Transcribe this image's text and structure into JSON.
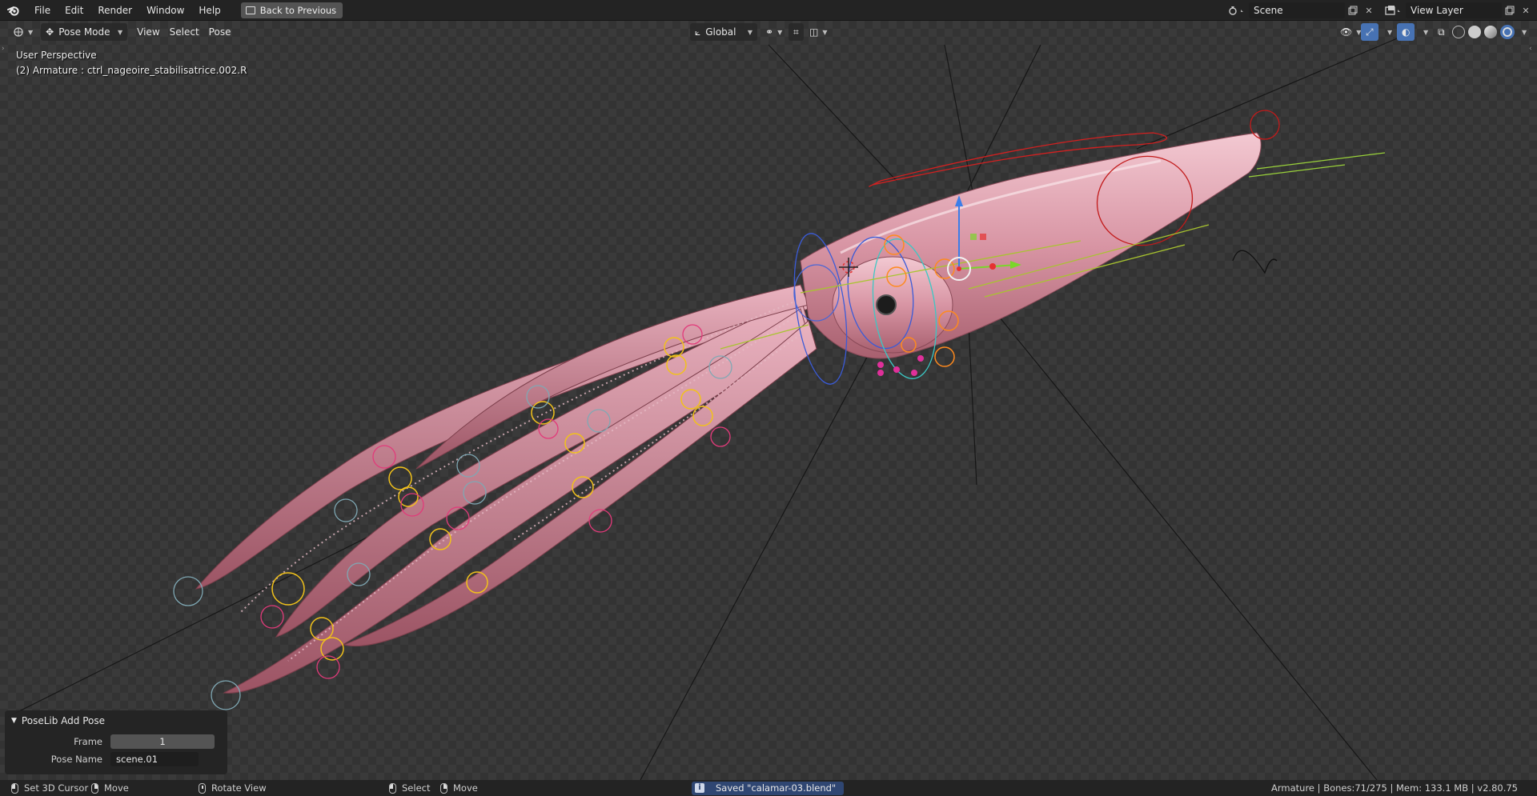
{
  "topbar": {
    "menus": [
      "File",
      "Edit",
      "Render",
      "Window",
      "Help"
    ],
    "back_button": "Back to Previous",
    "scene_name": "Scene",
    "view_layer": "View Layer"
  },
  "viewport_header": {
    "mode": "Pose Mode",
    "menus": [
      "View",
      "Select",
      "Pose"
    ],
    "orientation": "Global"
  },
  "overlay": {
    "perspective": "User Perspective",
    "active_object": "(2) Armature : ctrl_nageoire_stabilisatrice.002.R"
  },
  "operator_panel": {
    "title": "PoseLib Add Pose",
    "frame_label": "Frame",
    "frame_value": "1",
    "pose_name_label": "Pose Name",
    "pose_name_value": "scene.01"
  },
  "statusbar": {
    "left_click": "Set 3D Cursor",
    "left_drag": "Move",
    "middle": "Rotate View",
    "select": "Select",
    "move": "Move",
    "message": "Saved \"calamar-03.blend\"",
    "stats": "Armature | Bones:71/275  | Mem: 133.1 MB | v2.80.75"
  },
  "colors": {
    "viewport_bg": "#3b3b3b",
    "header_bg": "#232323",
    "squid_body": "#d99aa8",
    "message_bg": "#2f4672"
  }
}
